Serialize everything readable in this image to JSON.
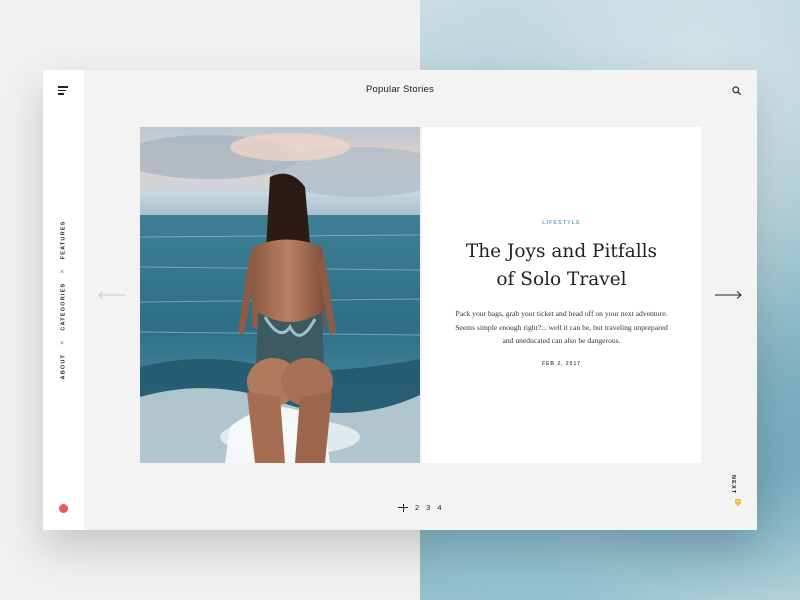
{
  "header": {
    "title": "Popular Stories"
  },
  "side_nav": {
    "items": [
      "ABOUT",
      "CATEGORIES",
      "FEATURES"
    ],
    "separator": "×"
  },
  "article": {
    "category": "LIFESTYLE",
    "title_line1": "The Joys and Pitfalls",
    "title_line2": "of Solo Travel",
    "excerpt_line1": "Pack your bags, grab your ticket and head off on your next adventure.",
    "excerpt_line2": "Seems simple enough right?... well it can be, but traveling unprepared",
    "excerpt_line3": "and uneducated can also be dangerous.",
    "date": "FEB 2, 2017"
  },
  "pagination": {
    "pages": [
      "2",
      "3",
      "4"
    ],
    "current": 1
  },
  "next_label": "NEXT",
  "icons": {
    "menu": "menu-icon",
    "search": "search-icon",
    "prev": "arrow-left-icon",
    "next": "arrow-right-icon",
    "indicator": "red-dot-icon",
    "edit": "pencil-icon"
  },
  "colors": {
    "accent": "#6ea6c8",
    "indicator": "#e85a5a",
    "pencil": "#f4b73a"
  }
}
